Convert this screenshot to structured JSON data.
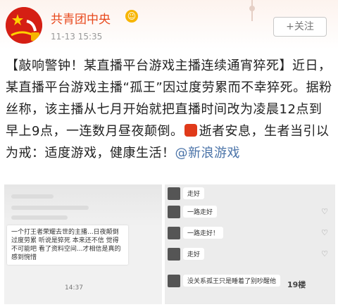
{
  "post": {
    "author": "共青团中央",
    "verified_emoji": "😉",
    "timestamp": "11-13 15:35",
    "follow_label": "+关注",
    "text_part1": "【敲响警钟！某直播平台游戏主播连续通宵猝死】近日，某直播平台游戏主播“孤王”因过度劳累而不幸猝死。据粉丝称，该主播从七月开始就把直播时间改为凌晨12点到早上9点，一连数月昼夜颠倒。",
    "text_part2": "逝者安息，生者当引以为戒：适度游戏，健康生活！",
    "mention": "@新浪游戏"
  },
  "left_image": {
    "caption": "一个打王者荣耀去世的主播...日夜颠倒过度劳累 听说是猝死 本来还不信 觉得不可能吧 看了资料空间...才相信是真的 感到惋惜",
    "time": "14:37"
  },
  "right_image": {
    "comments": [
      {
        "text": "走好"
      },
      {
        "text": "一路走好"
      },
      {
        "text": "一路走好！"
      },
      {
        "text": "走好"
      },
      {
        "text": "没关系孤王只是睡着了别吵醒他"
      }
    ]
  },
  "watermark": "19楼",
  "colors": {
    "author": "#e8491d",
    "mention": "#4a73a8"
  }
}
